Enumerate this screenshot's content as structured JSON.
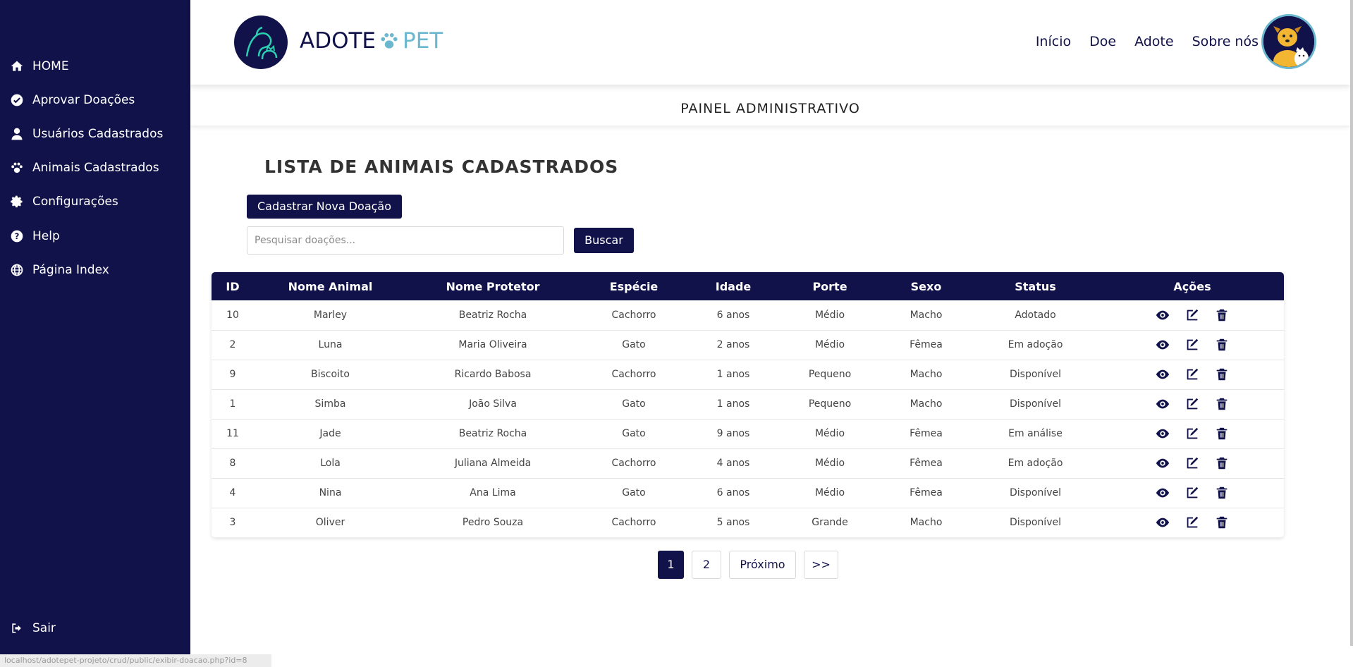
{
  "sidebar": {
    "items": [
      {
        "label": "HOME",
        "icon": "home-icon"
      },
      {
        "label": "Aprovar Doações",
        "icon": "check-circle-icon"
      },
      {
        "label": "Usuários Cadastrados",
        "icon": "user-icon"
      },
      {
        "label": "Animais Cadastrados",
        "icon": "paw-icon"
      },
      {
        "label": "Configurações",
        "icon": "gear-icon"
      },
      {
        "label": "Help",
        "icon": "help-icon"
      },
      {
        "label": "Página Index",
        "icon": "globe-icon"
      }
    ],
    "logout": "Sair",
    "status_url": "localhost/adotepet-projeto/crud/public/exibir-doacao.php?id=8"
  },
  "header": {
    "brand_adote": "ADOTE",
    "brand_pet": "PET",
    "nav": [
      "Início",
      "Doe",
      "Adote",
      "Sobre nós"
    ]
  },
  "panel_title": "PAINEL ADMINISTRATIVO",
  "list_title": "LISTA DE ANIMAIS CADASTRADOS",
  "new_button": "Cadastrar Nova Doação",
  "search": {
    "placeholder": "Pesquisar doações...",
    "value": "",
    "button": "Buscar"
  },
  "table": {
    "headers": [
      "ID",
      "Nome Animal",
      "Nome Protetor",
      "Espécie",
      "Idade",
      "Porte",
      "Sexo",
      "Status",
      "Ações"
    ],
    "rows": [
      [
        "10",
        "Marley",
        "Beatriz Rocha",
        "Cachorro",
        "6 anos",
        "Médio",
        "Macho",
        "Adotado"
      ],
      [
        "2",
        "Luna",
        "Maria Oliveira",
        "Gato",
        "2 anos",
        "Médio",
        "Fêmea",
        "Em adoção"
      ],
      [
        "9",
        "Biscoito",
        "Ricardo Babosa",
        "Cachorro",
        "1 anos",
        "Pequeno",
        "Macho",
        "Disponível"
      ],
      [
        "1",
        "Simba",
        "João Silva",
        "Gato",
        "1 anos",
        "Pequeno",
        "Macho",
        "Disponível"
      ],
      [
        "11",
        "Jade",
        "Beatriz Rocha",
        "Gato",
        "9 anos",
        "Médio",
        "Fêmea",
        "Em análise"
      ],
      [
        "8",
        "Lola",
        "Juliana Almeida",
        "Cachorro",
        "4 anos",
        "Médio",
        "Fêmea",
        "Em adoção"
      ],
      [
        "4",
        "Nina",
        "Ana Lima",
        "Gato",
        "6 anos",
        "Médio",
        "Fêmea",
        "Disponível"
      ],
      [
        "3",
        "Oliver",
        "Pedro Souza",
        "Cachorro",
        "5 anos",
        "Grande",
        "Macho",
        "Disponível"
      ]
    ],
    "action_icons": [
      "eye-icon",
      "edit-icon",
      "trash-icon"
    ]
  },
  "pagination": {
    "pages": [
      "1",
      "2"
    ],
    "current": "1",
    "next": "Próximo",
    "last": ">>"
  },
  "colors": {
    "primary": "#12124a",
    "accent": "#6bb7cf"
  }
}
